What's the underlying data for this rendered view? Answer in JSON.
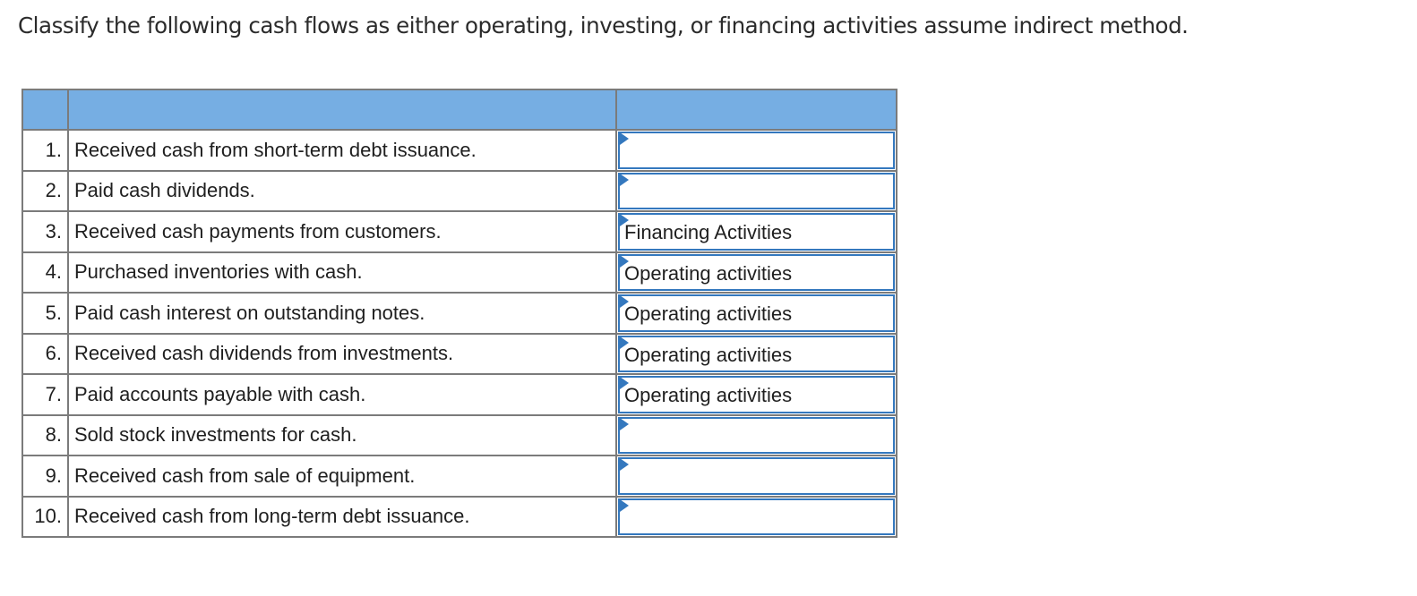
{
  "question": {
    "title": "Classify the following cash flows as either operating, investing, or financing activities assume indirect method."
  },
  "table": {
    "header": {
      "num": "",
      "description": "",
      "answer": ""
    },
    "colors": {
      "header_bg": "#76aee3",
      "answer_border": "#3478be",
      "grid_line": "#7b7b7b"
    },
    "rows": [
      {
        "num": "1.",
        "description": "Received cash from short-term debt issuance.",
        "answer": ""
      },
      {
        "num": "2.",
        "description": "Paid cash dividends.",
        "answer": ""
      },
      {
        "num": "3.",
        "description": "Received cash payments from customers.",
        "answer": "Financing Activities"
      },
      {
        "num": "4.",
        "description": "Purchased inventories with cash.",
        "answer": "Operating activities"
      },
      {
        "num": "5.",
        "description": "Paid cash interest on outstanding notes.",
        "answer": "Operating activities"
      },
      {
        "num": "6.",
        "description": "Received cash dividends from investments.",
        "answer": "Operating activities"
      },
      {
        "num": "7.",
        "description": "Paid accounts payable with cash.",
        "answer": "Operating activities"
      },
      {
        "num": "8.",
        "description": "Sold stock investments for cash.",
        "answer": ""
      },
      {
        "num": "9.",
        "description": "Received cash from sale of equipment.",
        "answer": ""
      },
      {
        "num": "10.",
        "description": "Received cash from long-term debt issuance.",
        "answer": ""
      }
    ]
  }
}
